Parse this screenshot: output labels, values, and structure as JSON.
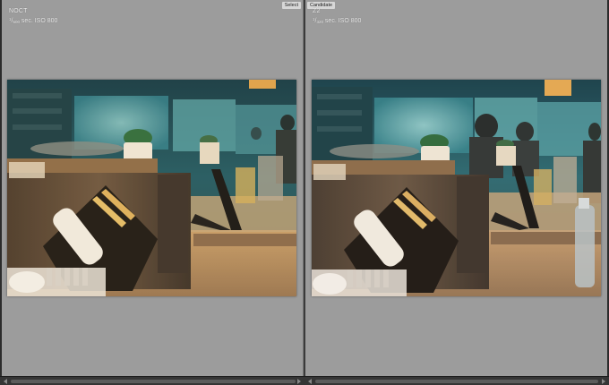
{
  "left_pane": {
    "camera": "NOCT",
    "exposure_num": "1",
    "exposure_den": "500",
    "exposure_rest": " sec. ISO 800",
    "select_label": "Select"
  },
  "right_pane": {
    "candidate_label": "Candidate",
    "camera": "Z2",
    "exposure_num": "1",
    "exposure_den": "320",
    "exposure_rest": " sec. ISO 800"
  },
  "colors": {
    "pane_bg": "#9c9c9c",
    "photo_left_cast": "#d9a35d",
    "photo_right_cast": "#c9a06b",
    "window_teal": "#2f8290"
  },
  "icons": [
    "scroll-left-arrow-icon",
    "scroll-right-arrow-icon"
  ]
}
